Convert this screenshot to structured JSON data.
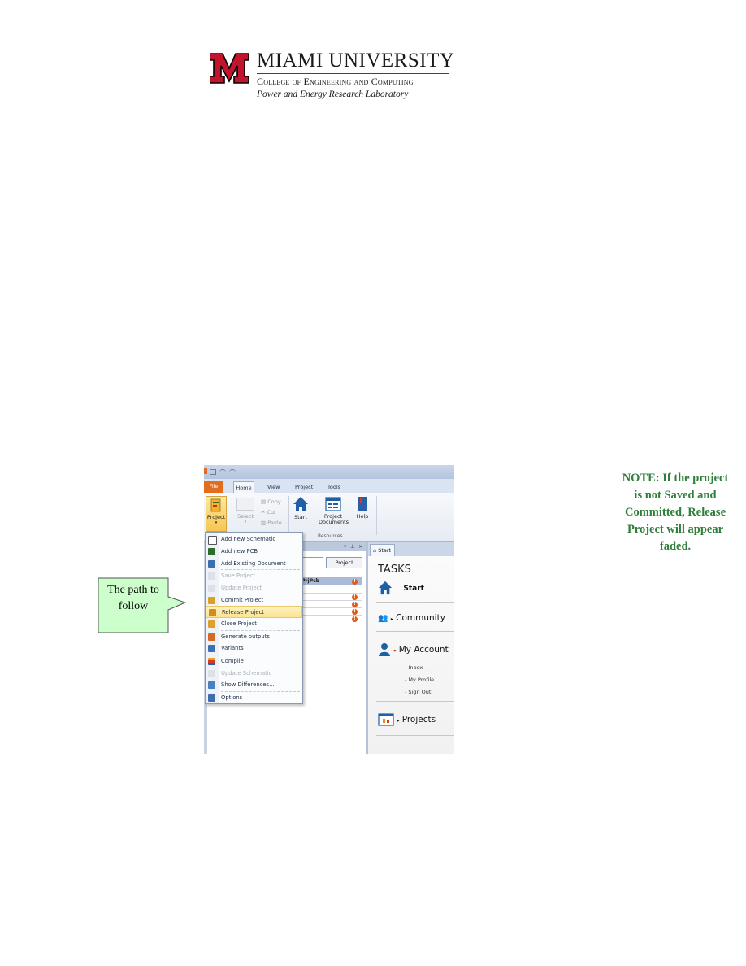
{
  "header": {
    "university": "MIAMI UNIVERSITY",
    "college": "College of Engineering and Computing",
    "lab": "Power and Energy Research Laboratory"
  },
  "callout": {
    "text_line1": "The path to",
    "text_line2": "follow"
  },
  "note": {
    "line1": "NOTE: If the project",
    "line2": "is not Saved and",
    "line3": "Committed, Release",
    "line4": "Project will appear",
    "line5": "faded."
  },
  "screenshot": {
    "tabs": {
      "file": "File",
      "home": "Home",
      "view": "View",
      "project": "Project",
      "tools": "Tools"
    },
    "ribbon": {
      "project": "Project",
      "select": "Select",
      "copy": "Copy",
      "cut": "Cut",
      "paste": "Paste",
      "start": "Start",
      "project_documents_1": "Project",
      "project_documents_2": "Documents",
      "help": "Help",
      "resources": "Resources"
    },
    "left_pane": {
      "project_button": "Project",
      "prjpcb": ".PrjPcb"
    },
    "menu": [
      {
        "label": "Add new Schematic",
        "enabled": true,
        "color": "#4a7a3a"
      },
      {
        "label": "Add new PCB",
        "enabled": true,
        "color": "#2f6b2a"
      },
      {
        "label": "Add Existing Document",
        "enabled": true,
        "color": "#3a6fb0"
      },
      {
        "label": "Save Project",
        "enabled": false,
        "color": "#c8ccd4"
      },
      {
        "label": "Update Project",
        "enabled": false,
        "color": "#c8ccd4"
      },
      {
        "label": "Commit Project",
        "enabled": true,
        "color": "#d9a128"
      },
      {
        "label": "Release Project",
        "enabled": true,
        "color": "#d48a1c"
      },
      {
        "label": "Close Project",
        "enabled": true,
        "color": "#e0a030"
      },
      {
        "label": "Generate outputs",
        "enabled": true,
        "color": "#d46a2a"
      },
      {
        "label": "Variants",
        "enabled": true,
        "color": "#3d6fb5"
      },
      {
        "label": "Compile",
        "enabled": true,
        "color": "#e2a21e"
      },
      {
        "label": "Update Schematic",
        "enabled": false,
        "color": "#c8ccd4"
      },
      {
        "label": "Show Differences...",
        "enabled": true,
        "color": "#4a80c2"
      },
      {
        "label": "Options",
        "enabled": true,
        "color": "#3f6db0"
      }
    ],
    "start_tab": "Start",
    "tasks": {
      "title": "TASKS",
      "start": "Start",
      "community": "Community",
      "my_account": "My Account",
      "inbox": "- Inbox",
      "my_profile": "- My Profile",
      "sign_out": "- Sign Out",
      "projects": "Projects"
    }
  }
}
